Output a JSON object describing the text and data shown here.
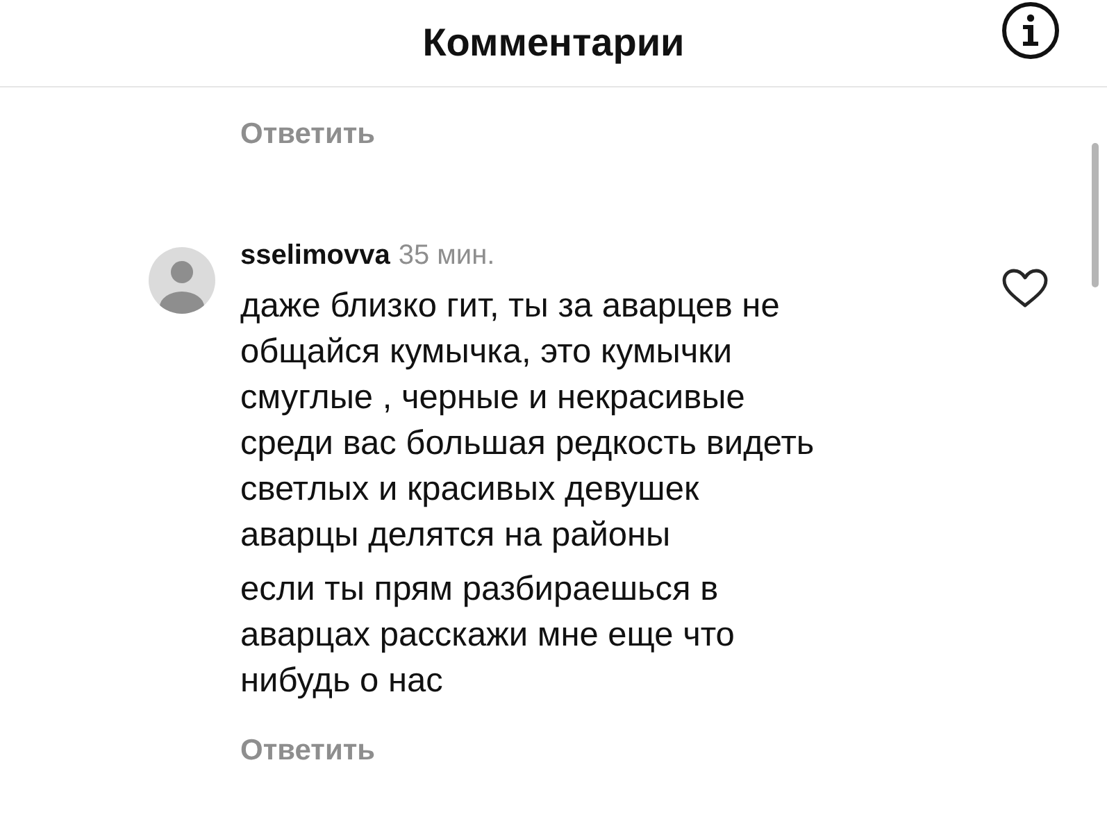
{
  "header": {
    "title": "Комментарии"
  },
  "previous_comment": {
    "reply": "Ответить"
  },
  "comment": {
    "author": "sselimovva",
    "time": "35 мин.",
    "liked": false,
    "paragraphs": [
      "даже близко гит, ты за аварцев не\nобщайся кумычка, это кумычки\nсмуглые , черные и некрасивые\nсреди вас большая редкость видеть\nсветлых и красивых девушек\nаварцы делятся на районы",
      "если ты прям разбираешься в\nаварцах расскажи мне еще что\nнибудь о нас"
    ],
    "reply": "Ответить"
  }
}
